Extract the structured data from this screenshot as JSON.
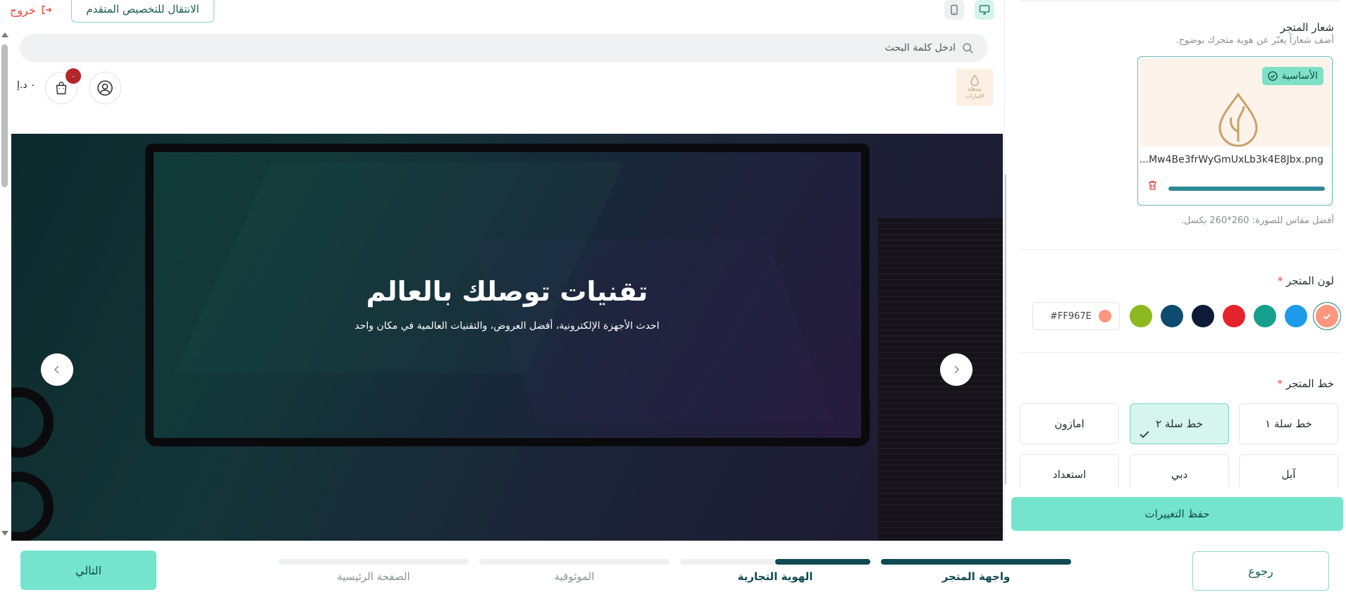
{
  "topbar": {
    "exit_label": "خروج",
    "advanced_button": "الانتقال للتخصيص المتقدم"
  },
  "preview": {
    "search_placeholder": "ادخل كلمة البحث",
    "cart_badge": "٠",
    "cart_total": "٠ د.إ",
    "logo_text_line1": "مدهلة",
    "logo_text_line2": "الإمارات",
    "hero": {
      "title": "تقنيات توصلك بالعالم",
      "subtitle": "احدث الأجهزة الإلكترونية، أفضل العروض، والتقنيات العالمية في مكان واحد"
    }
  },
  "sidebar": {
    "logo_section": {
      "heading": "شعار المتجر",
      "hint": "أضف شعاراً يعبّر عن هوية متجرك بوضوح.",
      "primary_badge": "الأساسية",
      "file_name": "...Mw4Be3frWyGmUxLb3k4E8Jbx.png",
      "upload_progress": 1.0,
      "size_hint": "أفضل مقاس للصورة: 260*260 بكسل."
    },
    "color_section": {
      "heading": "لون المتجر",
      "required_mark": "*",
      "swatches": [
        "#FF967E",
        "#1E9BE9",
        "#14A08C",
        "#E5232D",
        "#0C1B38",
        "#0D4C6E",
        "#8DB81F"
      ],
      "selected_index": 0,
      "hex_value": "#FF967E"
    },
    "font_section": {
      "heading": "خط المتجر",
      "required_mark": "*",
      "fonts": [
        "خط سلة ١",
        "خط سلة ٢",
        "امازون",
        "آبل",
        "دبي",
        "استعداد"
      ],
      "selected_index": 1
    },
    "save_button": "حفظ التغييرات"
  },
  "wizard": {
    "next_button": "التالي",
    "back_button": "رجوع",
    "steps": [
      {
        "label": "واجهة المتجر",
        "progress": 1.0,
        "active": true
      },
      {
        "label": "الهوية التجارية",
        "progress": 0.5,
        "active": true
      },
      {
        "label": "الموثوقية",
        "progress": 0.0,
        "active": false
      },
      {
        "label": "الصفحة الرئيسية",
        "progress": 0.0,
        "active": false
      }
    ]
  },
  "colors": {
    "accent": "#75E4CD",
    "brand_dark": "#0F4A53",
    "danger": "#E5483D"
  }
}
